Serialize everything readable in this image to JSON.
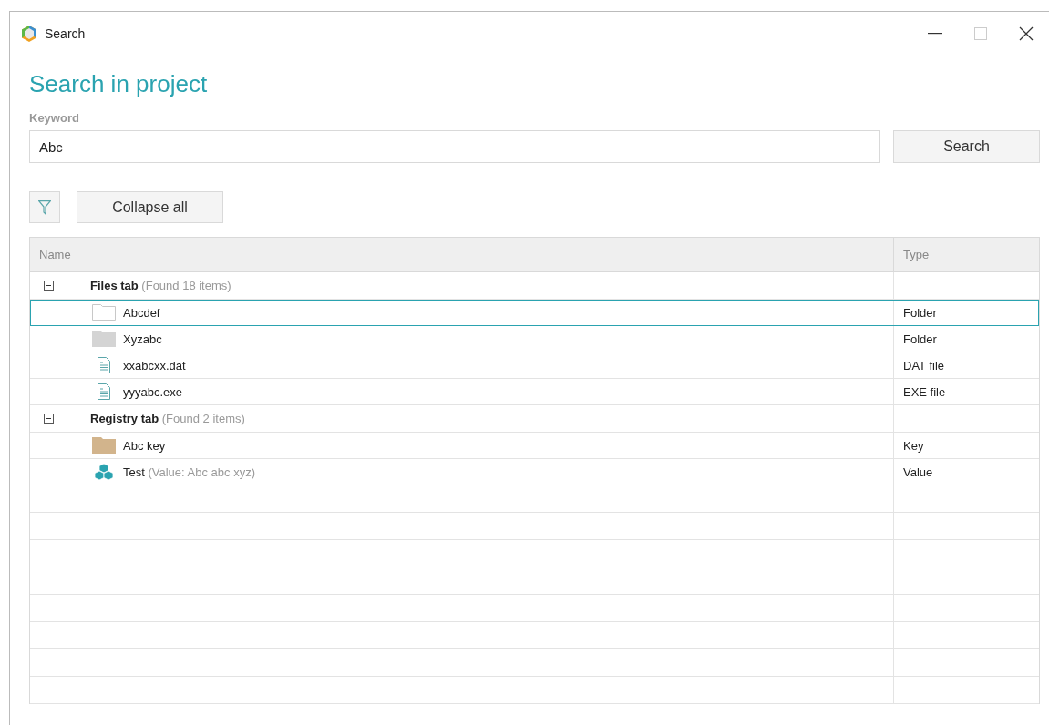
{
  "window": {
    "title": "Search"
  },
  "heading": "Search in project",
  "keyword": {
    "label": "Keyword",
    "value": "Abc"
  },
  "search_button": "Search",
  "collapse_button": "Collapse all",
  "table": {
    "columns": [
      "Name",
      "Type"
    ],
    "groups": [
      {
        "label": "Files tab",
        "count": "(Found 18 items)",
        "expanded": true,
        "children": [
          {
            "kind": "folder-outline",
            "name": "Abcdef",
            "type": "Folder",
            "selected": true
          },
          {
            "kind": "folder-grey",
            "name": "Xyzabc",
            "type": "Folder",
            "selected": false
          },
          {
            "kind": "file",
            "name": "xxabcxx.dat",
            "type": "DAT file",
            "selected": false
          },
          {
            "kind": "file",
            "name": "yyyabc.exe",
            "type": "EXE file",
            "selected": false
          }
        ]
      },
      {
        "label": "Registry tab",
        "count": "(Found 2 items)",
        "expanded": true,
        "children": [
          {
            "kind": "folder-tan",
            "name": "Abc key",
            "type": "Key",
            "selected": false
          },
          {
            "kind": "value",
            "name": "Test",
            "detail": "(Value: Abc abc xyz)",
            "type": "Value",
            "selected": false
          }
        ]
      }
    ]
  }
}
